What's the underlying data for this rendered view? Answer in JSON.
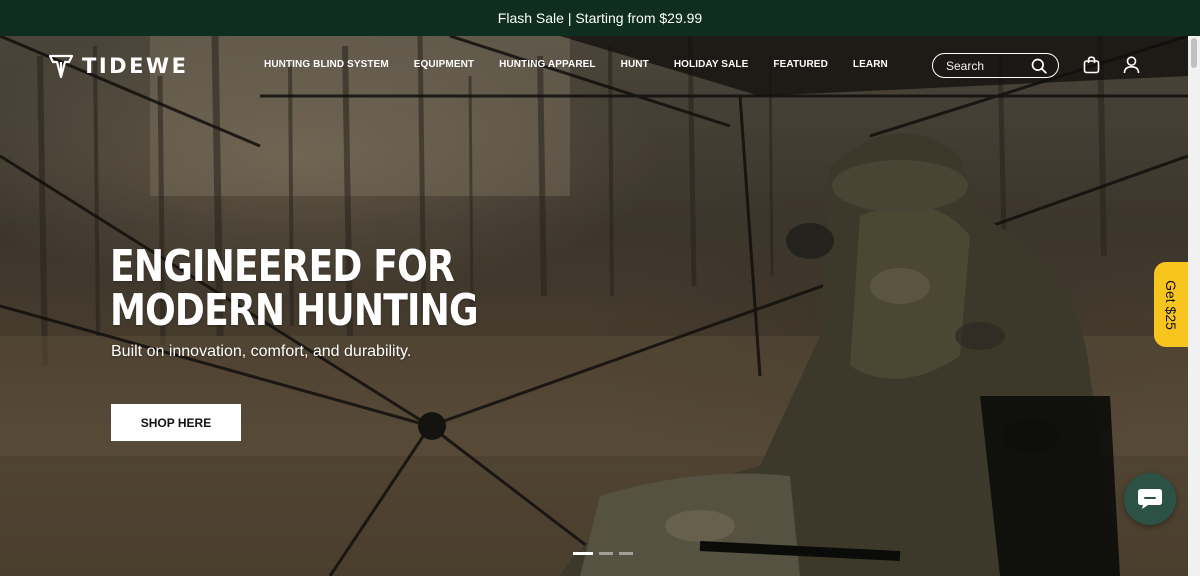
{
  "announcement": {
    "text": "Flash Sale | Starting from $29.99"
  },
  "brand": {
    "name": "TIDEWE",
    "logo_icon": "tidewe-mark-icon"
  },
  "nav": {
    "items": [
      {
        "label": "HUNTING BLIND SYSTEM"
      },
      {
        "label": "EQUIPMENT"
      },
      {
        "label": "HUNTING APPAREL"
      },
      {
        "label": "HUNT"
      },
      {
        "label": "HOLIDAY SALE"
      },
      {
        "label": "FEATURED"
      },
      {
        "label": "LEARN"
      }
    ]
  },
  "search": {
    "placeholder": "Search",
    "icon": "search-icon"
  },
  "header_icons": {
    "cart": "shopping-bag-icon",
    "account": "user-icon"
  },
  "hero": {
    "headline_line1": "ENGINEERED FOR",
    "headline_line2": "MODERN HUNTING",
    "subheadline": "Built on innovation, comfort, and durability.",
    "cta_label": "SHOP HERE"
  },
  "carousel": {
    "slide_count": 3,
    "active_index": 0
  },
  "side_tab": {
    "label": "Get $25",
    "color": "#f7c51e"
  },
  "chat": {
    "icon": "chat-bubble-icon",
    "color": "#2c5246"
  },
  "colors": {
    "announcement_bg": "#0f2e1f",
    "text_light": "#ffffff"
  }
}
